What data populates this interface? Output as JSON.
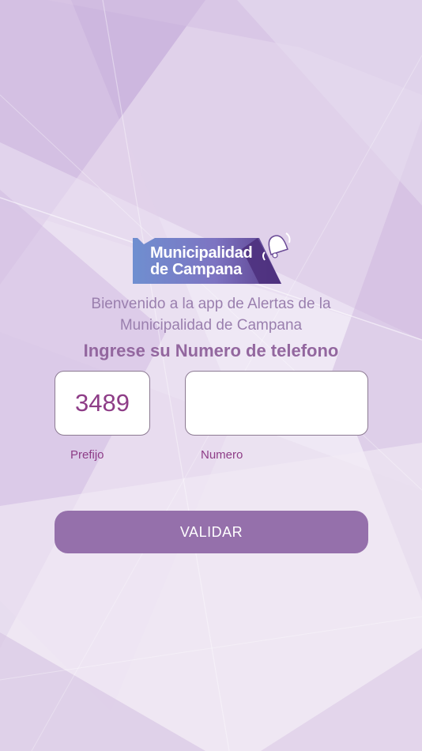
{
  "theme": {
    "background_base": "#e7dcef",
    "accent": "#9570ab",
    "text_accent": "#8e3d87"
  },
  "logo": {
    "line1": "Municipalidad",
    "line2": "de Campana",
    "icon": "bell-icon"
  },
  "welcome": {
    "line1": "Bienvenido a la app de Alertas de la",
    "line2": "Municipalidad de Campana"
  },
  "form": {
    "title": "Ingrese su Numero de telefono",
    "prefix": {
      "value": "3489",
      "label": "Prefijo"
    },
    "number": {
      "value": "",
      "label": "Numero"
    },
    "submit_label": "VALIDAR"
  }
}
